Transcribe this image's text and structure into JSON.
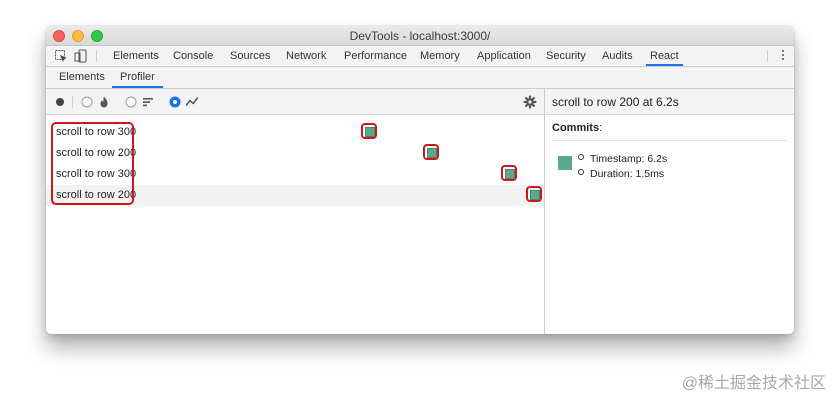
{
  "window": {
    "title": "DevTools - localhost:3000/"
  },
  "main_tabs": [
    "Elements",
    "Console",
    "Sources",
    "Network",
    "Performance",
    "Memory",
    "Application",
    "Security",
    "Audits",
    "React"
  ],
  "active_main_tab": "React",
  "sub_tabs": [
    "Elements",
    "Profiler"
  ],
  "active_sub_tab": "Profiler",
  "toolbar": {
    "icons": [
      "record-icon",
      "flame-radio-icon",
      "flame-icon",
      "ranked-radio-icon",
      "ranked-icon",
      "interactions-radio-icon",
      "interactions-icon",
      "settings-icon"
    ],
    "selected_view": "interactions"
  },
  "interactions": [
    {
      "label": "scroll to row 300"
    },
    {
      "label": "scroll to row 200"
    },
    {
      "label": "scroll to row 300"
    },
    {
      "label": "scroll to row 200"
    }
  ],
  "detail": {
    "title": "scroll to row 200 at 6.2s",
    "commits_label": "Commits",
    "commits_colon": ":",
    "items": [
      "Timestamp: 6.2s",
      "Duration: 1.5ms"
    ]
  },
  "colors": {
    "commit": "#59a98f",
    "highlight": "#d0151c",
    "accent": "#1a73e8"
  },
  "watermark": "@稀土掘金技术社区"
}
